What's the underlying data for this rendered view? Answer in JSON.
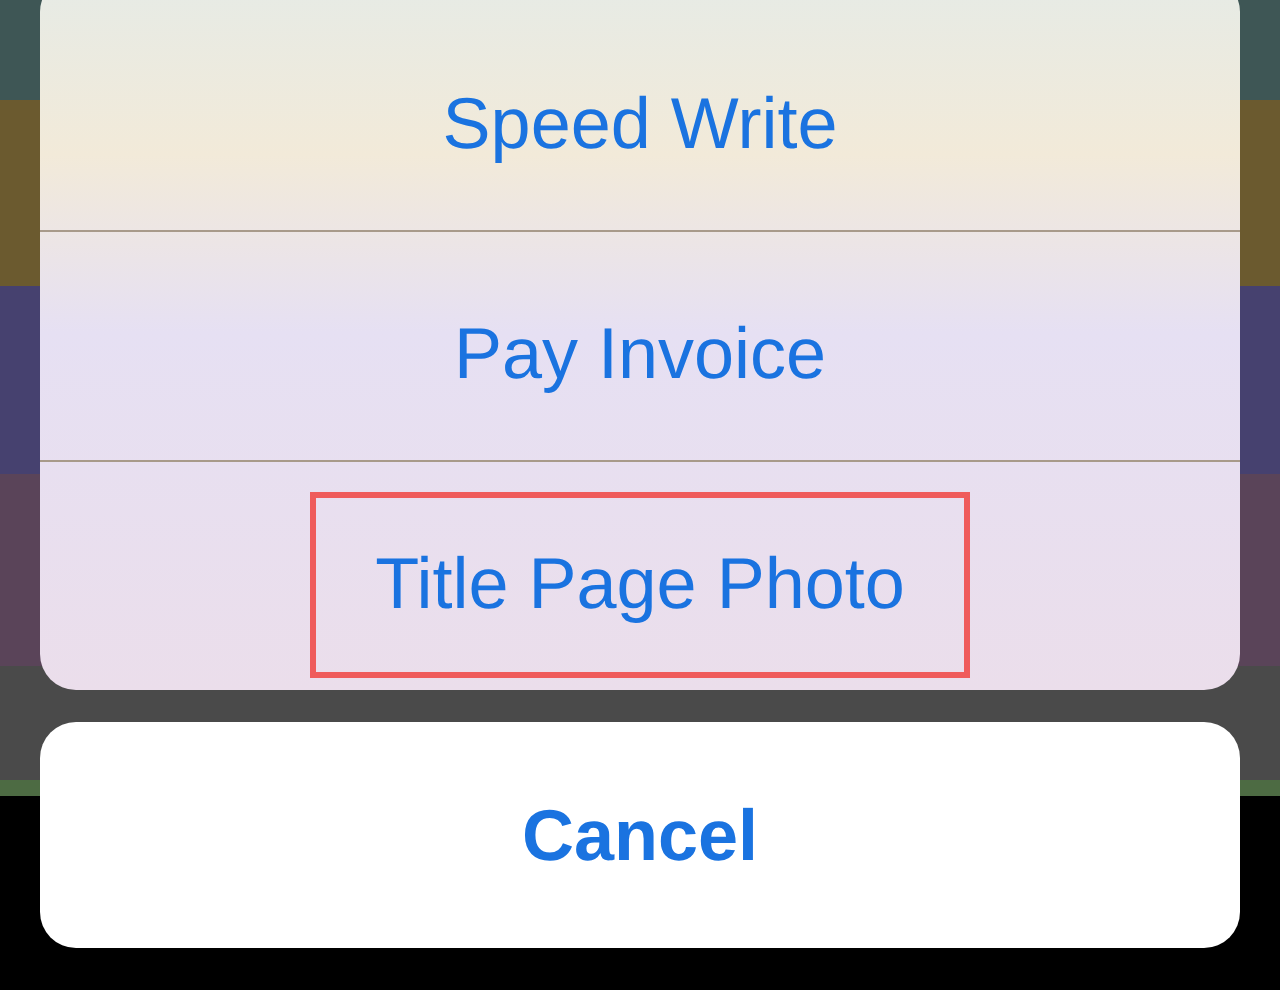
{
  "background_list": {
    "rows": [
      {
        "color": "#3e5655"
      },
      {
        "color": "#6b5a2f"
      },
      {
        "color": "#46416f"
      },
      {
        "color": "#5a4459"
      },
      {
        "color": "#4a4a4a"
      },
      {
        "color": "#4d6b43"
      }
    ]
  },
  "action_sheet": {
    "actions": [
      {
        "label": "Speed Write",
        "highlighted": false
      },
      {
        "label": "Pay Invoice",
        "highlighted": false
      },
      {
        "label": "Title Page Photo",
        "highlighted": true
      }
    ],
    "cancel": "Cancel"
  }
}
